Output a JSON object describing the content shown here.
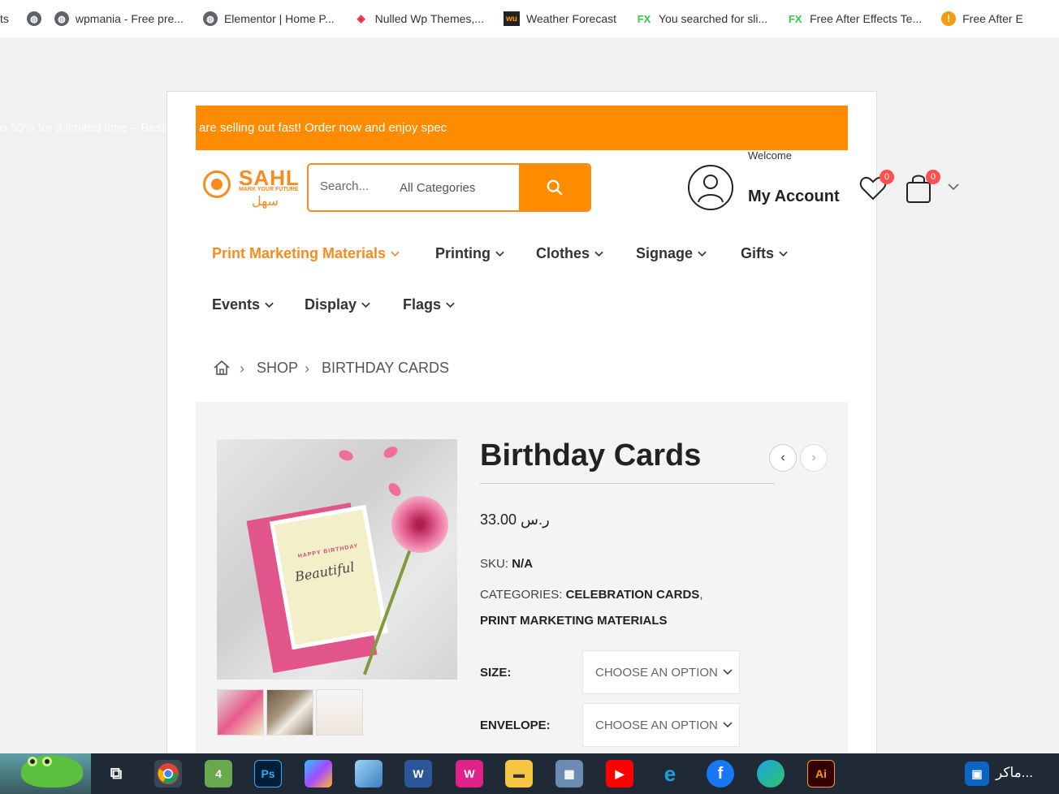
{
  "bookmarks": [
    {
      "label": "ts",
      "icon": "none"
    },
    {
      "label": "",
      "icon": "globe-icon"
    },
    {
      "label": "wpmania - Free pre...",
      "icon": "globe-icon"
    },
    {
      "label": "Elementor | Home P...",
      "icon": "globe-icon"
    },
    {
      "label": "Nulled Wp Themes,...",
      "icon": "nulled-icon"
    },
    {
      "label": "Weather Forecast",
      "icon": "wu-icon"
    },
    {
      "label": "You searched for sli...",
      "icon": "fx-icon"
    },
    {
      "label": "Free After Effects Te...",
      "icon": "fx-icon"
    },
    {
      "label": "Free After E",
      "icon": "orange-icon"
    }
  ],
  "promo": {
    "text": "are selling out fast! Order now and enjoy spec",
    "ghost": "o 50% for a limited time – Bests"
  },
  "brand": {
    "name": "SAHL",
    "tagline": "MARK YOUR FUTURE",
    "arabic": "سهل",
    "accent": "#f68b1f"
  },
  "search": {
    "placeholder": "Search...",
    "category": "All Categories"
  },
  "account": {
    "welcome": "Welcome",
    "label": "My Account"
  },
  "wishlist": {
    "count": "0"
  },
  "cart": {
    "count": "0"
  },
  "nav": [
    {
      "label": "Print Marketing Materials",
      "active": true
    },
    {
      "label": "Printing"
    },
    {
      "label": "Clothes"
    },
    {
      "label": "Signage"
    },
    {
      "label": "Gifts"
    },
    {
      "label": "Events"
    },
    {
      "label": "Display"
    },
    {
      "label": "Flags"
    }
  ],
  "breadcrumb": {
    "shop": "SHOP",
    "current": "BIRTHDAY CARDS"
  },
  "product": {
    "title": "Birthday Cards",
    "price": "ر.س 33.00",
    "sku_label": "SKU:",
    "sku": "N/A",
    "categories_label": "CATEGORIES:",
    "category1": "CELEBRATION CARDS",
    "category2": "PRINT MARKETING MATERIALS",
    "image_text": "Beautiful",
    "image_small": "HAPPY BIRTHDAY",
    "attributes": [
      {
        "label": "SIZE:",
        "value": "CHOOSE AN OPTION"
      },
      {
        "label": "ENVELOPE:",
        "value": "CHOOSE AN OPTION"
      }
    ]
  },
  "taskbar": {
    "tray_text": "ماكر..."
  }
}
